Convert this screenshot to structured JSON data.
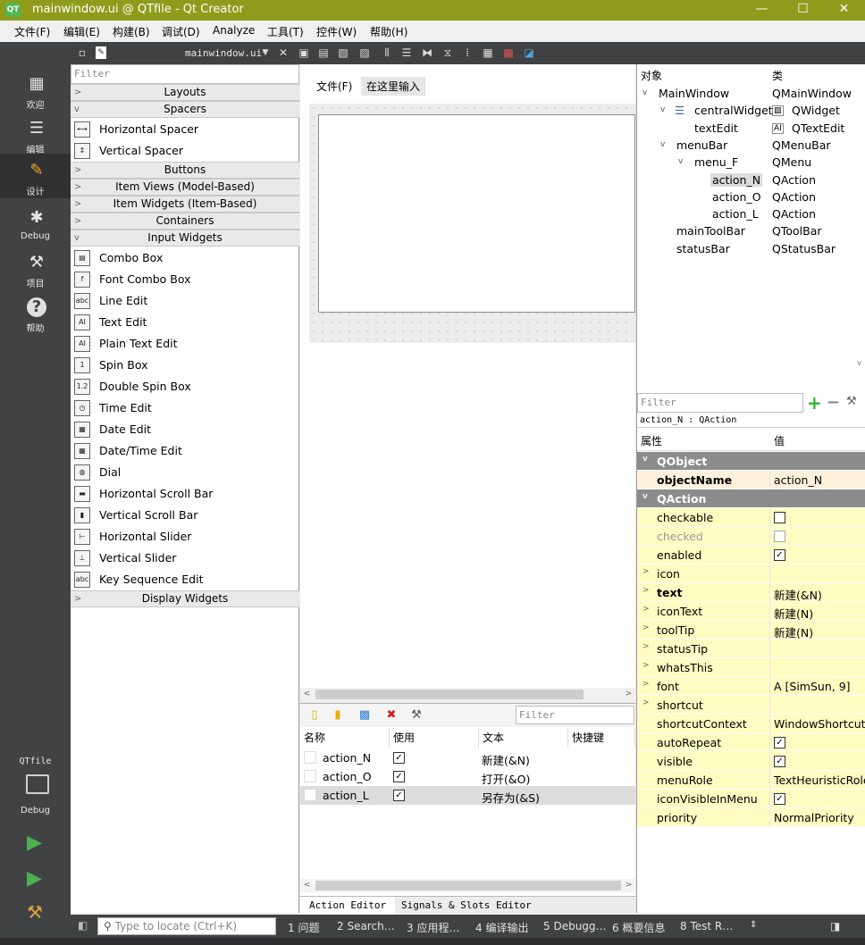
{
  "window": {
    "title": "mainwindow.ui @ QTfile - Qt Creator",
    "logo": "QT",
    "minimize": "—",
    "maximize": "☐",
    "close": "✕"
  },
  "menubar": [
    "文件(F)",
    "编辑(E)",
    "构建(B)",
    "调试(D)",
    "Analyze",
    "工具(T)",
    "控件(W)",
    "帮助(H)"
  ],
  "modes": [
    {
      "label": "欢迎",
      "icon": "grid-icon",
      "glyph": "▦"
    },
    {
      "label": "编辑",
      "icon": "document-icon",
      "glyph": "☰"
    },
    {
      "label": "设计",
      "icon": "pencil-icon",
      "glyph": "✎"
    },
    {
      "label": "Debug",
      "icon": "bug-icon",
      "glyph": "✱"
    },
    {
      "label": "项目",
      "icon": "wrench-icon",
      "glyph": "⚒"
    },
    {
      "label": "帮助",
      "icon": "help-icon",
      "glyph": "?"
    }
  ],
  "target": {
    "project": "QTfile",
    "mode": "Debug",
    "run_glyph": "▶",
    "debug_glyph": "▶",
    "build_glyph": "⚒",
    "monitor_glyph": "🖵"
  },
  "editor": {
    "filename": "mainwindow.ui*"
  },
  "widgetbox": {
    "filter_placeholder": "Filter",
    "categories_top": [
      "Layouts",
      "Spacers"
    ],
    "spacers": [
      "Horizontal Spacer",
      "Vertical Spacer"
    ],
    "categories_mid": [
      "Buttons",
      "Item Views (Model-Based)",
      "Item Widgets (Item-Based)",
      "Containers",
      "Input Widgets"
    ],
    "input_widgets": [
      "Combo Box",
      "Font Combo Box",
      "Line Edit",
      "Text Edit",
      "Plain Text Edit",
      "Spin Box",
      "Double Spin Box",
      "Time Edit",
      "Date Edit",
      "Date/Time Edit",
      "Dial",
      "Horizontal Scroll Bar",
      "Vertical Scroll Bar",
      "Horizontal Slider",
      "Vertical Slider",
      "Key Sequence Edit"
    ],
    "input_widget_icons": [
      "▤",
      "f",
      "abc",
      "AI",
      "AI",
      "1",
      "1.2",
      "◷",
      "▦",
      "▦",
      "◍",
      "▬",
      "▮",
      "⊢",
      "⊥",
      "abc"
    ],
    "categories_bottom": [
      "Display Widgets"
    ]
  },
  "form": {
    "menu_file": "文件(F)",
    "menu_placeholder": "在这里输入"
  },
  "action_editor": {
    "filter_placeholder": "Filter",
    "columns": [
      "名称",
      "使用",
      "文本",
      "快捷键"
    ],
    "rows": [
      {
        "name": "action_N",
        "used": "✓",
        "text": "新建(&N)",
        "selected": false
      },
      {
        "name": "action_O",
        "used": "✓",
        "text": "打开(&O)",
        "selected": false
      },
      {
        "name": "action_L",
        "used": "✓",
        "text": "另存为(&S)",
        "selected": true
      }
    ],
    "tabs": [
      "Action Editor",
      "Signals & Slots Editor"
    ]
  },
  "object_inspector": {
    "columns": [
      "对象",
      "类"
    ],
    "rows": [
      {
        "name": "MainWindow",
        "class": "QMainWindow",
        "arrow": "v"
      },
      {
        "name": "centralWidget",
        "class": "QWidget",
        "arrow": "v"
      },
      {
        "name": "textEdit",
        "class": "QTextEdit",
        "arrow": ""
      },
      {
        "name": "menuBar",
        "class": "QMenuBar",
        "arrow": "v"
      },
      {
        "name": "menu_F",
        "class": "QMenu",
        "arrow": "v"
      },
      {
        "name": "action_N",
        "class": "QAction",
        "arrow": ""
      },
      {
        "name": "action_O",
        "class": "QAction",
        "arrow": ""
      },
      {
        "name": "action_L",
        "class": "QAction",
        "arrow": ""
      },
      {
        "name": "mainToolBar",
        "class": "QToolBar",
        "arrow": ""
      },
      {
        "name": "statusBar",
        "class": "QStatusBar",
        "arrow": ""
      }
    ]
  },
  "property_editor": {
    "filter_placeholder": "Filter",
    "object_line": "action_N : QAction",
    "columns": [
      "属性",
      "值"
    ],
    "rows": [
      {
        "key": "QObject",
        "value": "",
        "kind": "group"
      },
      {
        "key": "objectName",
        "value": "action_N",
        "kind": "orange",
        "bold": true
      },
      {
        "key": "QAction",
        "value": "",
        "kind": "group"
      },
      {
        "key": "checkable",
        "value": "",
        "kind": "yellow",
        "cb": "off"
      },
      {
        "key": "checked",
        "value": "",
        "kind": "yellow",
        "cb": "off",
        "dim": true
      },
      {
        "key": "enabled",
        "value": "",
        "kind": "yellow",
        "cb": "on"
      },
      {
        "key": "icon",
        "value": "",
        "kind": "yellow",
        "exp": true
      },
      {
        "key": "text",
        "value": "新建(&N)",
        "kind": "yellow",
        "exp": true,
        "bold": true
      },
      {
        "key": "iconText",
        "value": "新建(N)",
        "kind": "yellow",
        "exp": true
      },
      {
        "key": "toolTip",
        "value": "新建(N)",
        "kind": "yellow",
        "exp": true
      },
      {
        "key": "statusTip",
        "value": "",
        "kind": "yellow",
        "exp": true
      },
      {
        "key": "whatsThis",
        "value": "",
        "kind": "yellow",
        "exp": true
      },
      {
        "key": "font",
        "value": "A  [SimSun, 9]",
        "kind": "yellow",
        "exp": true
      },
      {
        "key": "shortcut",
        "value": "",
        "kind": "yellow",
        "exp": true
      },
      {
        "key": "shortcutContext",
        "value": "WindowShortcut",
        "kind": "yellow"
      },
      {
        "key": "autoRepeat",
        "value": "",
        "kind": "yellow",
        "cb": "on"
      },
      {
        "key": "visible",
        "value": "",
        "kind": "yellow",
        "cb": "on"
      },
      {
        "key": "menuRole",
        "value": "TextHeuristicRole",
        "kind": "yellow"
      },
      {
        "key": "iconVisibleInMenu",
        "value": "",
        "kind": "yellow",
        "cb": "on"
      },
      {
        "key": "priority",
        "value": "NormalPriority",
        "kind": "yellow"
      }
    ]
  },
  "statusbar": {
    "locate_placeholder": "Type to locate (Ctrl+K)",
    "panes": [
      "1 问题",
      "2 Search…",
      "3 应用程…",
      "4 编译输出",
      "5 Debugg…",
      "6 概要信息",
      "8 Test R…"
    ]
  },
  "colors": {
    "titlebar": "#8f9b1a",
    "sidebar": "#404244",
    "group_row": "#8c8c8c",
    "property_yellow": "#fffcc2",
    "property_orange": "#fff1dc"
  }
}
